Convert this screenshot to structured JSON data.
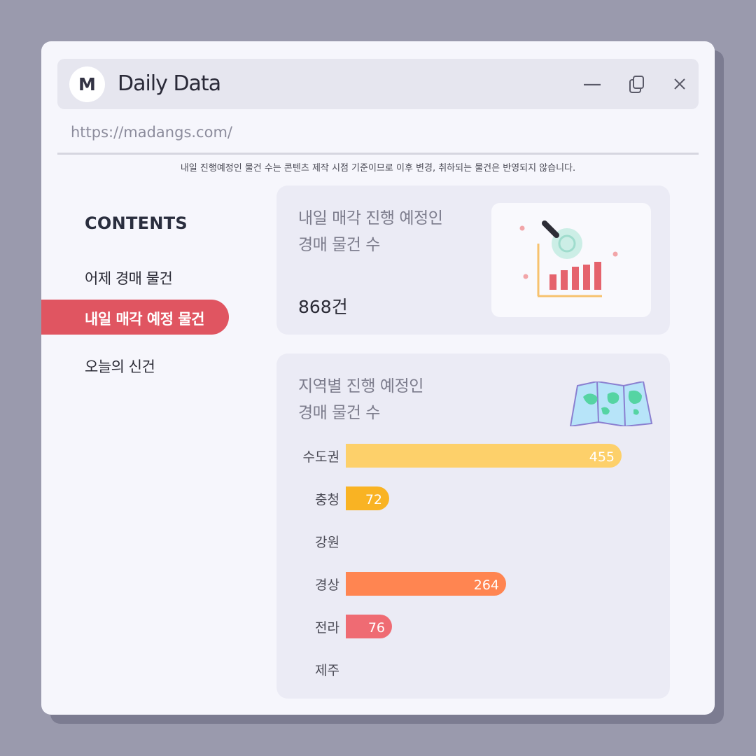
{
  "window": {
    "logo_letter": "M",
    "title": "Daily Data",
    "url": "https://madangs.com/",
    "notice": "내일 진행예정인 물건 수는 콘텐츠 제작 시점 기준이므로 이후 변경, 취하되는 물건은 반영되지 않습니다."
  },
  "sidebar": {
    "heading": "CONTENTS",
    "items": [
      {
        "label": "어제 경매 물건",
        "active": false
      },
      {
        "label": "내일 매각 예정 물건",
        "active": true
      },
      {
        "label": "오늘의 신건",
        "active": false
      }
    ]
  },
  "summary_card": {
    "title_line1": "내일 매각 진행 예정인",
    "title_line2": "경매 물건 수",
    "value": "868건",
    "illustration_icon": "magnifier-chart-icon"
  },
  "region_card": {
    "title_line1": "지역별 진행 예정인",
    "title_line2": "경매 물건 수",
    "illustration_icon": "map-icon"
  },
  "chart_data": {
    "type": "bar",
    "orientation": "horizontal",
    "categories": [
      "수도권",
      "충청",
      "강원",
      "경상",
      "전라",
      "제주"
    ],
    "values": [
      455,
      72,
      null,
      264,
      76,
      null
    ],
    "value_labels": [
      "455",
      "72",
      "",
      "264",
      "76",
      ""
    ],
    "colors": [
      "#fdd06a",
      "#f9b323",
      "#f9b323",
      "#ff8551",
      "#ef6b73",
      "#ef6b73"
    ],
    "title": "지역별 진행 예정인 경매 물건 수"
  },
  "colors": {
    "accent": "#e05561",
    "window_bg": "#f6f6fc",
    "card_bg": "#ebebf5",
    "page_bg": "#9a9aad"
  }
}
